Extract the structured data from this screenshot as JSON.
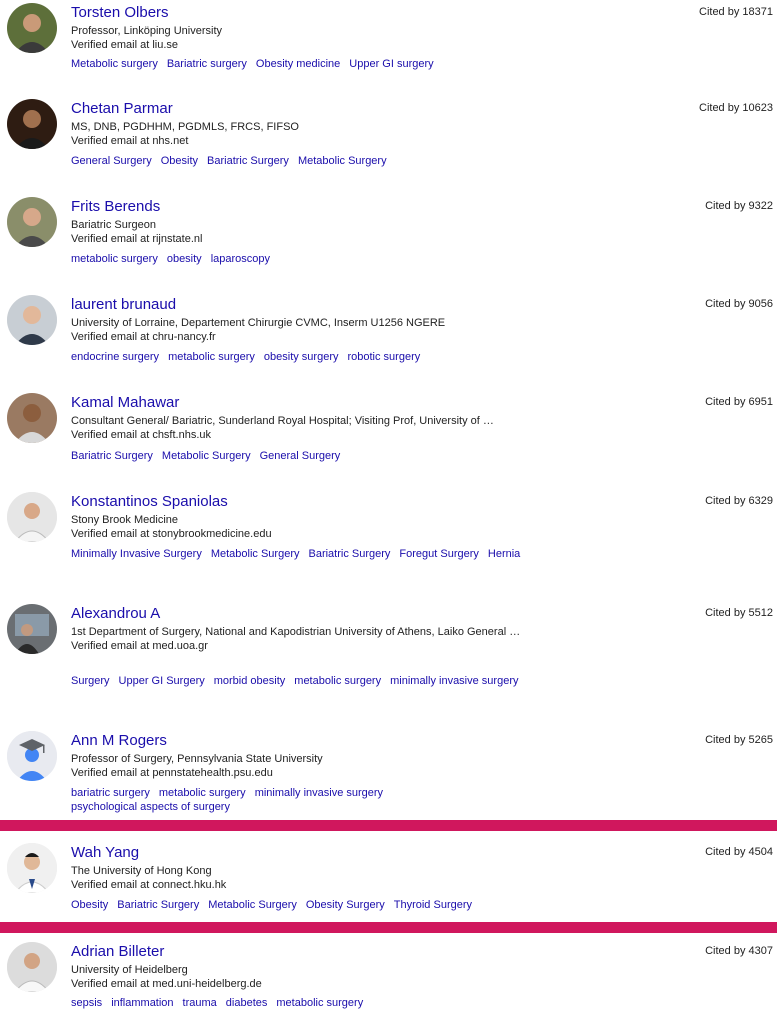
{
  "profiles": [
    {
      "name": "Torsten Olbers",
      "cited": "Cited by 18371",
      "affiliation": "Professor, Linköping University",
      "email": "Verified email at liu.se",
      "tags": [
        "Metabolic surgery",
        "Bariatric surgery",
        "Obesity medicine",
        "Upper GI surgery"
      ]
    },
    {
      "name": "Chetan Parmar",
      "cited": "Cited by 10623",
      "affiliation": "MS, DNB, PGDHHM, PGDMLS, FRCS, FIFSO",
      "email": "Verified email at nhs.net",
      "tags": [
        "General Surgery",
        "Obesity",
        "Bariatric Surgery",
        "Metabolic Surgery"
      ]
    },
    {
      "name": "Frits Berends",
      "cited": "Cited by 9322",
      "affiliation": "Bariatric Surgeon",
      "email": "Verified email at rijnstate.nl",
      "tags": [
        "metabolic surgery",
        "obesity",
        "laparoscopy"
      ]
    },
    {
      "name": "laurent brunaud",
      "cited": "Cited by 9056",
      "affiliation": "University of Lorraine, Departement Chirurgie CVMC, Inserm U1256 NGERE",
      "email": "Verified email at chru-nancy.fr",
      "tags": [
        "endocrine surgery",
        "metabolic surgery",
        "obesity surgery",
        "robotic surgery"
      ]
    },
    {
      "name": "Kamal Mahawar",
      "cited": "Cited by 6951",
      "affiliation": "Consultant General/ Bariatric, Sunderland Royal Hospital; Visiting Prof, University of …",
      "email": "Verified email at chsft.nhs.uk",
      "tags": [
        "Bariatric Surgery",
        "Metabolic Surgery",
        "General Surgery"
      ]
    },
    {
      "name": "Konstantinos Spaniolas",
      "cited": "Cited by 6329",
      "affiliation": "Stony Brook Medicine",
      "email": "Verified email at stonybrookmedicine.edu",
      "tags": [
        "Minimally Invasive Surgery",
        "Metabolic Surgery",
        "Bariatric Surgery",
        "Foregut Surgery",
        "Hernia"
      ]
    },
    {
      "name": "Alexandrou A",
      "cited": "Cited by 5512",
      "affiliation": "1st Department of Surgery, National and Kapodistrian University of Athens, Laiko General …",
      "email": "Verified email at med.uoa.gr",
      "tags": [
        "Surgery",
        "Upper GI Surgery",
        "morbid obesity",
        "metabolic surgery",
        "minimally invasive surgery"
      ]
    },
    {
      "name": "Ann M Rogers",
      "cited": "Cited by 5265",
      "affiliation": "Professor of Surgery, Pennsylvania State University",
      "email": "Verified email at pennstatehealth.psu.edu",
      "tags": [
        "bariatric surgery",
        "metabolic surgery",
        "minimally invasive surgery",
        "psychological aspects of surgery"
      ]
    },
    {
      "name": "Wah Yang",
      "cited": "Cited by 4504",
      "affiliation": "The University of Hong Kong",
      "email": "Verified email at connect.hku.hk",
      "tags": [
        "Obesity",
        "Bariatric Surgery",
        "Metabolic Surgery",
        "Obesity Surgery",
        "Thyroid Surgery"
      ]
    },
    {
      "name": "Adrian Billeter",
      "cited": "Cited by 4307",
      "affiliation": "University of Heidelberg",
      "email": "Verified email at med.uni-heidelberg.de",
      "tags": [
        "sepsis",
        "inflammation",
        "trauma",
        "diabetes",
        "metabolic surgery"
      ]
    }
  ],
  "colors": {
    "link": "#1a0dab",
    "highlight": "#d0175d"
  }
}
